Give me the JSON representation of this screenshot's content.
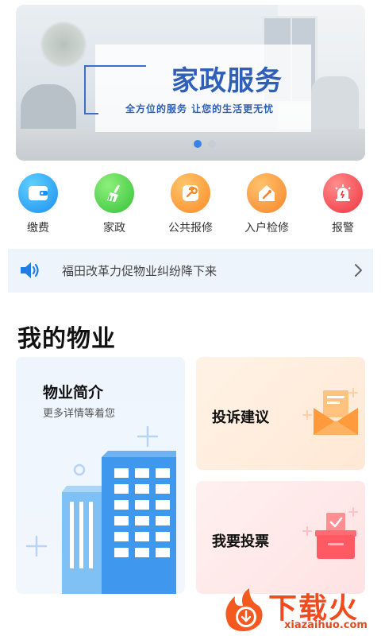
{
  "banner": {
    "title": "家政服务",
    "subtitle": "全方位的服务  让您的生活更无忧",
    "active_slide": 1,
    "slide_count": 2
  },
  "quick_actions": [
    {
      "label": "缴费",
      "icon": "wallet-icon",
      "color": "#1d8ff0"
    },
    {
      "label": "家政",
      "icon": "broom-icon",
      "color": "#35c13a"
    },
    {
      "label": "公共报修",
      "icon": "wrench-icon",
      "color": "#fb8a25"
    },
    {
      "label": "入户检修",
      "icon": "screwdriver-house-icon",
      "color": "#f6852a"
    },
    {
      "label": "报警",
      "icon": "alarm-icon",
      "color": "#f0333f"
    }
  ],
  "notice": {
    "icon": "speaker-icon",
    "text": "福田改革力促物业纠纷降下来"
  },
  "section": {
    "title": "我的物业"
  },
  "cards": {
    "intro": {
      "title": "物业简介",
      "subtitle": "更多详情等着您",
      "icon": "building-icon"
    },
    "complaint": {
      "title": "投诉建议",
      "icon": "mail-icon"
    },
    "vote": {
      "title": "我要投票",
      "icon": "ballot-box-icon"
    }
  },
  "watermark": {
    "brand": "下载火",
    "url": "xiazaihuo.com"
  },
  "colors": {
    "accent_blue": "#3d83e6",
    "notice_bg": "#eef4fb"
  }
}
